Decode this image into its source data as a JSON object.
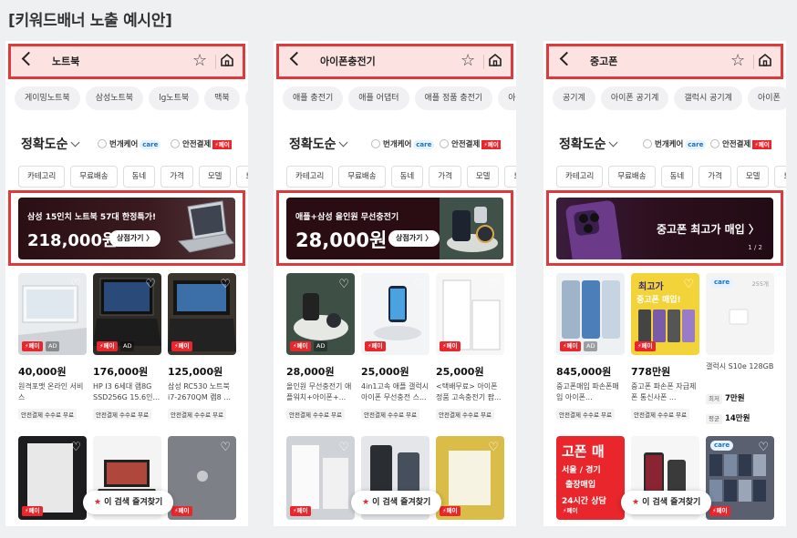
{
  "page_title": "[키워드배너 노출 예시안]",
  "common": {
    "sort_label": "정확도순",
    "opt_care": "번개케어",
    "care_badge": "care",
    "opt_safe_pay": "안전결제",
    "pay_badge": "⚡페이",
    "pay_tag": "⚡페이",
    "ad_tag": "AD",
    "fee_label": "안전결제 수수료 무료",
    "fav_button": "이 검색 즐겨찾기",
    "filters": [
      "카테고리",
      "무료배송",
      "동네",
      "가격",
      "모델",
      "브랜"
    ]
  },
  "phones": [
    {
      "keyword": "노트북",
      "chips": [
        "게이밍노트북",
        "삼성노트북",
        "lg노트북",
        "맥북",
        "l"
      ],
      "banner": {
        "line1": "삼성 15인치 노트북 57대 한정특가!",
        "price": "218,000원",
        "button": "상점가기 〉"
      },
      "products": [
        {
          "price": "40,000원",
          "name": "원격포맷 온라인 서비스"
        },
        {
          "price": "176,000원",
          "name": "HP I3 6세대 램8G SSD256G 15.6인..."
        },
        {
          "price": "125,000원",
          "name": "삼성 RC530 노트북 i7-2670QM 램8 ..."
        }
      ]
    },
    {
      "keyword": "아이폰충전기",
      "chips": [
        "애플 충전기",
        "애플 어댑터",
        "애플 정품 충전기",
        "아이폰"
      ],
      "banner": {
        "line1": "애플+삼성 올인원 무선충전기",
        "price": "28,000원",
        "button": "상점가기 〉"
      },
      "products": [
        {
          "price": "28,000원",
          "name": "올인원 무선충전기 애플워치+아이폰+..."
        },
        {
          "price": "25,000원",
          "name": "4in1고속 애플 갤럭시 아이폰 무선충전 스..."
        },
        {
          "price": "25,000원",
          "name": "<택배무료> 아이폰 정품 고속충전기 팝..."
        }
      ]
    },
    {
      "keyword": "중고폰",
      "chips": [
        "공기계",
        "아이폰 공기계",
        "갤럭시 공기계",
        "아이폰"
      ],
      "banner": {
        "line1": "중고폰 최고가 매입  〉",
        "page": "1 / 2",
        "image_text": "최고가 중고폰 매입!"
      },
      "products": [
        {
          "price": "845,000원",
          "name": "중고폰매입 파손폰매입 아이폰..."
        },
        {
          "price": "778만원",
          "name": "중고폰 파손폰 자급제폰 통신사폰 ..."
        },
        {
          "price": "",
          "name": "갤럭시 S10e 128GB",
          "count": "255개",
          "label_a": "최저",
          "price_a": "7만원",
          "label_b": "평균",
          "price_b": "14만원"
        }
      ],
      "row2_text": [
        "고폰 매",
        "서울 / 경기",
        "출장매입",
        "24시간 상담"
      ]
    }
  ]
}
